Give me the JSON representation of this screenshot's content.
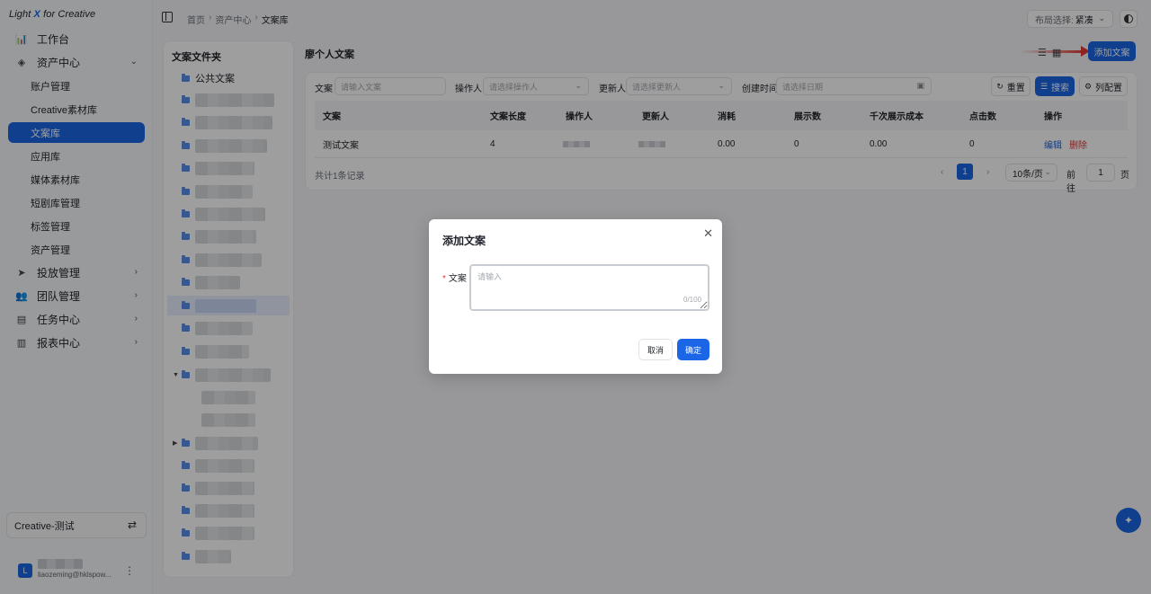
{
  "app": {
    "logo_left": "Light ",
    "logo_x": "X",
    "logo_right": " for Creative"
  },
  "sidebar": {
    "items": [
      {
        "label": "工作台",
        "icon": "chart-icon",
        "glyph": "📊"
      },
      {
        "label": "资产中心",
        "icon": "layers-icon",
        "glyph": "◈",
        "expanded": true
      },
      {
        "label": "账户管理",
        "sub": true
      },
      {
        "label": "Creative素材库",
        "sub": true
      },
      {
        "label": "文案库",
        "sub": true,
        "active": true
      },
      {
        "label": "应用库",
        "sub": true
      },
      {
        "label": "媒体素材库",
        "sub": true
      },
      {
        "label": "短剧库管理",
        "sub": true
      },
      {
        "label": "标签管理",
        "sub": true
      },
      {
        "label": "资产管理",
        "sub": true
      },
      {
        "label": "投放管理",
        "icon": "send-icon",
        "glyph": "➤"
      },
      {
        "label": "团队管理",
        "icon": "team-icon",
        "glyph": "👥"
      },
      {
        "label": "任务中心",
        "icon": "clipboard-icon",
        "glyph": "▤"
      },
      {
        "label": "报表中心",
        "icon": "bar-chart-icon",
        "glyph": "▥"
      }
    ],
    "account": "Creative-测试",
    "user_email": "liaozeming@hklspow..."
  },
  "topbar": {
    "breadcrumbs": [
      "首页",
      "资产中心",
      "文案库"
    ],
    "layout_label": "布局选择:",
    "layout_value": "紧凑"
  },
  "folders": {
    "title": "文案文件夹",
    "first": "公共文案"
  },
  "main": {
    "title": "廖个人文案",
    "add_button": "添加文案",
    "filters": {
      "copy_label": "文案",
      "copy_placeholder": "请输入文案",
      "operator_label": "操作人",
      "operator_placeholder": "请选择操作人",
      "updater_label": "更新人",
      "updater_placeholder": "请选择更新人",
      "created_label": "创建时间",
      "created_placeholder": "请选择日期",
      "reset": "重置",
      "search": "搜索",
      "columns": "列配置"
    },
    "table": {
      "headers": [
        "文案",
        "文案长度",
        "操作人",
        "更新人",
        "消耗",
        "展示数",
        "千次展示成本",
        "点击数",
        "操作"
      ],
      "rows": [
        {
          "copy": "测试文案",
          "length": "4",
          "cost": "0.00",
          "impressions": "0",
          "cpm": "0.00",
          "clicks": "0",
          "edit": "编辑",
          "delete": "删除"
        }
      ]
    },
    "total": "共计1条记录",
    "pager": {
      "current": "1",
      "page_size": "10条/页",
      "goto": "前往",
      "goto_value": "1",
      "unit": "页"
    }
  },
  "dialog": {
    "title": "添加文案",
    "field_label": "文案",
    "placeholder": "请输入",
    "count": "0/100",
    "cancel": "取消",
    "ok": "确定"
  }
}
